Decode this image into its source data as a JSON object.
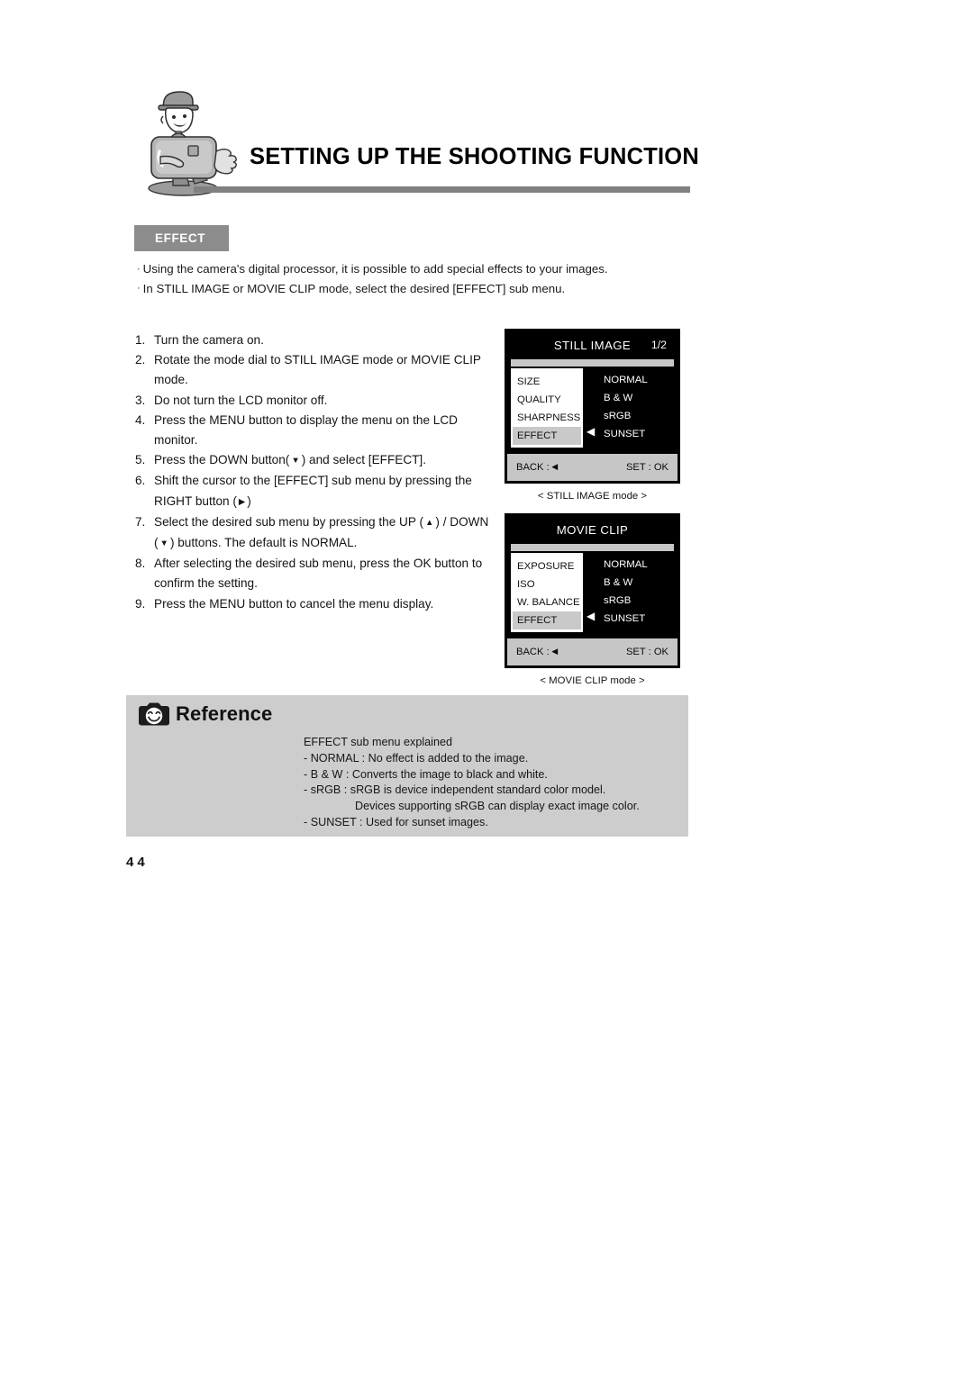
{
  "document": {
    "page_title": "SETTING UP THE SHOOTING FUNCTION",
    "page_number": "44",
    "section_badge": "EFFECT"
  },
  "intro": {
    "bullet_glyph": "·",
    "lines": [
      "Using the camera's digital processor, it is possible to add special effects to your images.",
      "In STILL IMAGE or MOVIE CLIP mode, select the desired [EFFECT] sub menu."
    ]
  },
  "steps": [
    {
      "num": "1.",
      "parts": [
        {
          "t": "Turn the camera on."
        }
      ]
    },
    {
      "num": "2.",
      "parts": [
        {
          "t": "Rotate the mode dial to STILL IMAGE mode or MOVIE CLIP mode."
        }
      ]
    },
    {
      "num": "3.",
      "parts": [
        {
          "t": "Do not turn the LCD monitor off."
        }
      ]
    },
    {
      "num": "4.",
      "parts": [
        {
          "t": "Press the MENU button to display the menu on the LCD monitor."
        }
      ]
    },
    {
      "num": "5.",
      "parts": [
        {
          "t": "Press the DOWN button("
        },
        {
          "arrow": "▼"
        },
        {
          "t": ") and select [EFFECT]."
        }
      ]
    },
    {
      "num": "6.",
      "parts": [
        {
          "t": "Shift the cursor to the [EFFECT] sub menu by pressing the RIGHT button ("
        },
        {
          "arrow": "▶"
        },
        {
          "t": ")"
        }
      ]
    },
    {
      "num": "7.",
      "parts": [
        {
          "t": "Select the desired sub menu by pressing the UP ("
        },
        {
          "arrow": "▲"
        },
        {
          "t": ") / DOWN ("
        },
        {
          "arrow": "▼"
        },
        {
          "t": ") buttons. The default is NORMAL."
        }
      ]
    },
    {
      "num": "8.",
      "parts": [
        {
          "t": "After selecting the desired sub menu, press the OK button to confirm the setting."
        }
      ]
    },
    {
      "num": "9.",
      "parts": [
        {
          "t": "Press the MENU button to cancel the menu display."
        }
      ]
    }
  ],
  "lcd_screens": [
    {
      "id": "still-image",
      "title": "STILL IMAGE",
      "page_indicator": "1/2",
      "menu_items": [
        {
          "label": "SIZE",
          "selected": false
        },
        {
          "label": "QUALITY",
          "selected": false
        },
        {
          "label": "SHARPNESS",
          "selected": false
        },
        {
          "label": "EFFECT",
          "selected": true
        }
      ],
      "sub_items": [
        "NORMAL",
        "B & W",
        "sRGB",
        "SUNSET"
      ],
      "cursor_glyph": "◀",
      "footer_left": "BACK :",
      "footer_left_glyph": "◀",
      "footer_right": "SET : OK",
      "caption": "< STILL IMAGE mode >"
    },
    {
      "id": "movie-clip",
      "title": "MOVIE CLIP",
      "page_indicator": "",
      "menu_items": [
        {
          "label": "EXPOSURE",
          "selected": false
        },
        {
          "label": "ISO",
          "selected": false
        },
        {
          "label": "W. BALANCE",
          "selected": false
        },
        {
          "label": "EFFECT",
          "selected": true
        }
      ],
      "sub_items": [
        "NORMAL",
        "B & W",
        "sRGB",
        "SUNSET"
      ],
      "cursor_glyph": "◀",
      "footer_left": "BACK :",
      "footer_left_glyph": "◀",
      "footer_right": "SET : OK",
      "caption": "< MOVIE CLIP mode >"
    }
  ],
  "reference": {
    "title": "Reference",
    "lines": [
      {
        "text": "EFFECT sub menu explained",
        "indented": false
      },
      {
        "text": "- NORMAL : No effect is added to the image.",
        "indented": false
      },
      {
        "text": "- B & W : Converts the image to black and white.",
        "indented": false
      },
      {
        "text": "- sRGB : sRGB is device independent standard color model.",
        "indented": false
      },
      {
        "text": "Devices supporting sRGB can display exact image color.",
        "indented": true
      },
      {
        "text": "- SUNSET : Used for sunset images.",
        "indented": false
      }
    ]
  },
  "colors": {
    "badge_gray": "#8c8c8c",
    "rule_gray": "#808080",
    "reference_bg": "#cdcdcd",
    "lcd_black": "#000000",
    "lcd_footer_gray": "#c6c6c6",
    "lcd_highlight_gray": "#c9c9c9"
  }
}
